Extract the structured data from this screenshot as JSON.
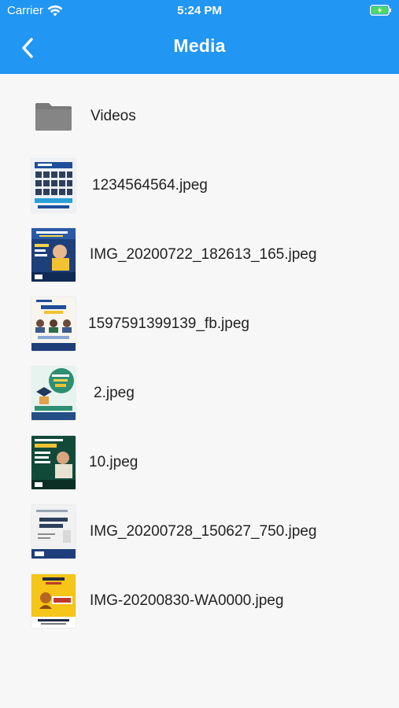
{
  "status_bar": {
    "carrier": "Carrier",
    "time": "5:24 PM",
    "wifi_icon": "wifi-icon",
    "battery_icon": "battery-charging-icon"
  },
  "app_bar": {
    "title": "Media",
    "back_icon": "chevron-left-icon",
    "background": "#2196f3"
  },
  "items": [
    {
      "type": "folder",
      "label": "Videos",
      "icon": "folder-icon"
    },
    {
      "type": "image",
      "label": "1234564564.jpeg",
      "icon": "image-thumbnail"
    },
    {
      "type": "image",
      "label": "IMG_20200722_182613_165.jpeg",
      "icon": "image-thumbnail"
    },
    {
      "type": "image",
      "label": "1597591399139_fb.jpeg",
      "icon": "image-thumbnail"
    },
    {
      "type": "image",
      "label": "2.jpeg",
      "icon": "image-thumbnail"
    },
    {
      "type": "image",
      "label": "10.jpeg",
      "icon": "image-thumbnail"
    },
    {
      "type": "image",
      "label": "IMG_20200728_150627_750.jpeg",
      "icon": "image-thumbnail"
    },
    {
      "type": "image",
      "label": "IMG-20200830-WA0000.jpeg",
      "icon": "image-thumbnail"
    }
  ]
}
